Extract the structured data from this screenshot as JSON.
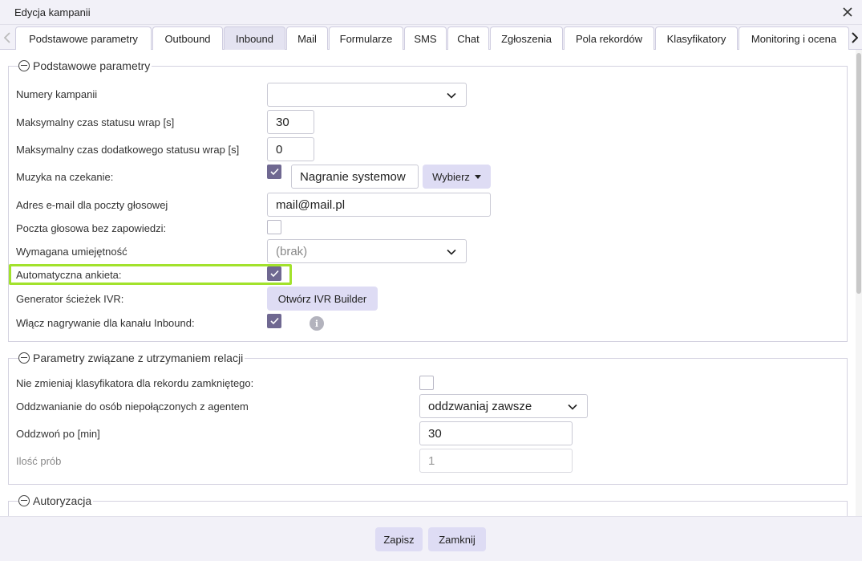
{
  "dialog": {
    "title": "Edycja kampanii"
  },
  "tabs": [
    {
      "label": "Podstawowe parametry"
    },
    {
      "label": "Outbound"
    },
    {
      "label": "Inbound"
    },
    {
      "label": "Mail"
    },
    {
      "label": "Formularze"
    },
    {
      "label": "SMS"
    },
    {
      "label": "Chat"
    },
    {
      "label": "Zgłoszenia"
    },
    {
      "label": "Pola rekordów"
    },
    {
      "label": "Klasyfikatory"
    },
    {
      "label": "Monitoring i ocena"
    }
  ],
  "active_tab": "Inbound",
  "section_basic": {
    "title": "Podstawowe parametry",
    "campaign_numbers": {
      "label": "Numery kampanii",
      "value": ""
    },
    "max_wrap": {
      "label": "Maksymalny czas statusu wrap [s]",
      "value": "30"
    },
    "max_extra_wrap": {
      "label": "Maksymalny czas dodatkowego statusu wrap [s]",
      "value": "0"
    },
    "hold_music": {
      "label": "Muzyka na czekanie:",
      "checked": true,
      "value": "Nagranie systemow",
      "choose_label": "Wybierz"
    },
    "voicemail_email": {
      "label": "Adres e-mail dla poczty głosowej",
      "value": "mail@mail.pl"
    },
    "voicemail_no_announce": {
      "label": "Poczta głosowa bez zapowiedzi:",
      "checked": false
    },
    "required_skill": {
      "label": "Wymagana umiejętność",
      "value": "(brak)"
    },
    "auto_survey": {
      "label": "Automatyczna ankieta:",
      "checked": true
    },
    "ivr_generator": {
      "label": "Generator ścieżek IVR:",
      "button": "Otwórz IVR Builder"
    },
    "inbound_recording": {
      "label": "Włącz nagrywanie dla kanału Inbound:",
      "checked": true
    }
  },
  "section_relations": {
    "title": "Parametry związane z utrzymaniem relacji",
    "keep_classifier": {
      "label": "Nie zmieniaj klasyfikatora dla rekordu zamkniętego:",
      "checked": false
    },
    "callback_mode": {
      "label": "Oddzwanianie do osób niepołączonych z agentem",
      "value": "oddzwaniaj zawsze"
    },
    "callback_after": {
      "label": "Oddzwoń po [min]",
      "value": "30"
    },
    "attempts": {
      "label": "Ilość prób",
      "value": "1"
    }
  },
  "section_auth": {
    "title": "Autoryzacja"
  },
  "footer": {
    "save_label": "Zapisz",
    "close_label": "Zamknij"
  },
  "colors": {
    "accent": "#6f6891",
    "button_bg": "#dedcf4",
    "highlight": "#a2e22c"
  }
}
